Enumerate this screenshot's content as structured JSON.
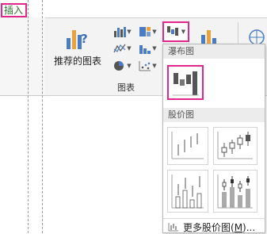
{
  "ribbon": {
    "tab_insert": "插入",
    "recommended_charts_line1": "推荐的图表",
    "group_label": "图表"
  },
  "dropdown": {
    "waterfall_section": "瀑布图",
    "stock_section": "股价图",
    "more_stock_prefix": "更多股价图(",
    "more_stock_key": "M",
    "more_stock_suffix": ")..."
  },
  "colors": {
    "highlight": "#e3268a",
    "insert_tab_text": "#2b6e2b",
    "bar_blue": "#4a7cc4",
    "bar_orange": "#e8a33c"
  }
}
